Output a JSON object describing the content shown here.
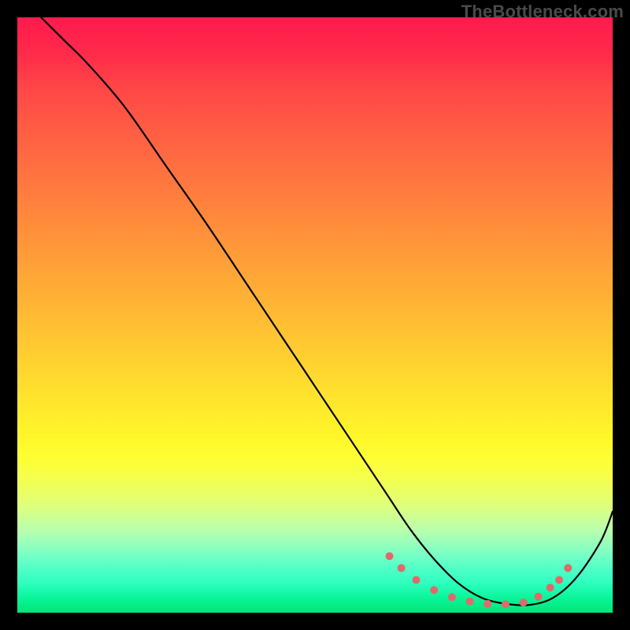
{
  "watermark": "TheBottleneck.com",
  "chart_data": {
    "type": "line",
    "title": "",
    "xlabel": "",
    "ylabel": "",
    "xlim": [
      0,
      100
    ],
    "ylim": [
      0,
      100
    ],
    "series": [
      {
        "name": "curve",
        "x": [
          4,
          8,
          12,
          18,
          25,
          32,
          40,
          48,
          56,
          62,
          66,
          70,
          74,
          78,
          82,
          86,
          90,
          94,
          98,
          100
        ],
        "y": [
          100,
          96,
          92,
          85,
          75,
          65,
          53,
          41,
          29,
          20,
          14,
          9,
          5,
          2.5,
          1.5,
          1.3,
          2.5,
          6,
          12,
          17
        ]
      }
    ],
    "markers": {
      "name": "trough-dots",
      "color": "#e06a6a",
      "points": [
        {
          "x": 62.5,
          "y": 9.5
        },
        {
          "x": 64.5,
          "y": 7.5
        },
        {
          "x": 67.0,
          "y": 5.5
        },
        {
          "x": 70.0,
          "y": 3.8
        },
        {
          "x": 73.0,
          "y": 2.6
        },
        {
          "x": 76.0,
          "y": 1.9
        },
        {
          "x": 79.0,
          "y": 1.5
        },
        {
          "x": 82.0,
          "y": 1.4
        },
        {
          "x": 85.0,
          "y": 1.7
        },
        {
          "x": 87.5,
          "y": 2.7
        },
        {
          "x": 89.5,
          "y": 4.2
        },
        {
          "x": 91.0,
          "y": 5.5
        },
        {
          "x": 92.5,
          "y": 7.5
        }
      ]
    },
    "grid": false,
    "legend": false
  }
}
